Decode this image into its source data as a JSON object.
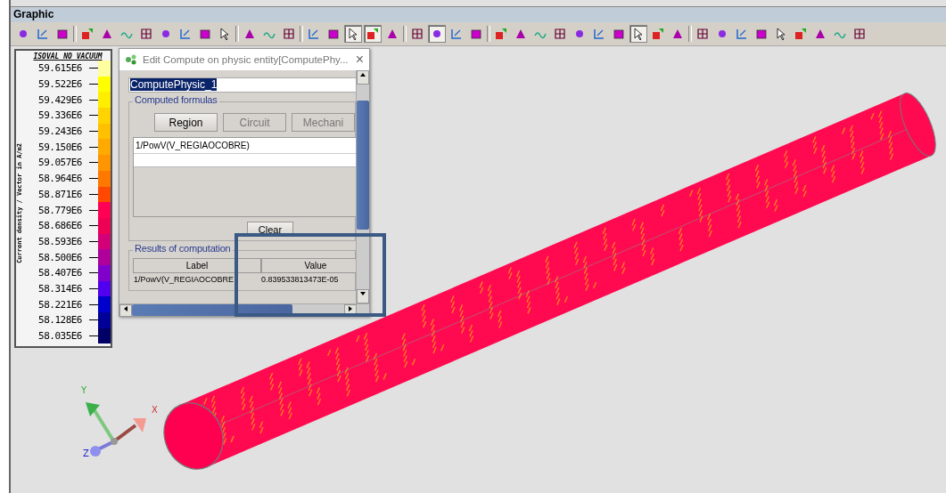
{
  "window": {
    "title": "Graphic"
  },
  "toolbar": [
    {
      "kind": "tool",
      "pressed": false
    },
    {
      "kind": "tool",
      "pressed": false
    },
    {
      "kind": "tool",
      "pressed": false
    },
    {
      "kind": "separator"
    },
    {
      "kind": "tool",
      "pressed": false
    },
    {
      "kind": "tool",
      "pressed": false
    },
    {
      "kind": "tool",
      "pressed": false
    },
    {
      "kind": "tool",
      "pressed": false
    },
    {
      "kind": "tool",
      "pressed": false
    },
    {
      "kind": "tool",
      "pressed": false
    },
    {
      "kind": "tool",
      "pressed": false
    },
    {
      "kind": "tool",
      "pressed": false
    },
    {
      "kind": "separator"
    },
    {
      "kind": "tool",
      "pressed": false
    },
    {
      "kind": "tool",
      "pressed": false
    },
    {
      "kind": "tool",
      "pressed": false
    },
    {
      "kind": "separator"
    },
    {
      "kind": "tool",
      "pressed": false
    },
    {
      "kind": "tool",
      "pressed": false
    },
    {
      "kind": "tool",
      "pressed": true
    },
    {
      "kind": "tool",
      "pressed": true
    },
    {
      "kind": "tool",
      "pressed": false
    },
    {
      "kind": "separator"
    },
    {
      "kind": "tool",
      "pressed": false
    },
    {
      "kind": "tool",
      "pressed": true
    },
    {
      "kind": "tool",
      "pressed": false
    },
    {
      "kind": "tool",
      "pressed": false
    },
    {
      "kind": "separator"
    },
    {
      "kind": "tool",
      "pressed": false
    },
    {
      "kind": "tool",
      "pressed": false
    },
    {
      "kind": "tool",
      "pressed": false
    },
    {
      "kind": "tool",
      "pressed": false
    },
    {
      "kind": "tool",
      "pressed": false
    },
    {
      "kind": "tool",
      "pressed": false
    },
    {
      "kind": "tool",
      "pressed": false
    },
    {
      "kind": "tool",
      "pressed": true
    },
    {
      "kind": "tool",
      "pressed": false
    },
    {
      "kind": "tool",
      "pressed": false
    },
    {
      "kind": "separator"
    },
    {
      "kind": "tool",
      "pressed": false
    },
    {
      "kind": "tool",
      "pressed": false
    },
    {
      "kind": "tool",
      "pressed": false
    },
    {
      "kind": "tool",
      "pressed": false
    },
    {
      "kind": "tool",
      "pressed": false
    },
    {
      "kind": "tool",
      "pressed": false
    },
    {
      "kind": "tool",
      "pressed": false
    },
    {
      "kind": "tool",
      "pressed": false
    },
    {
      "kind": "tool",
      "pressed": false
    }
  ],
  "legend": {
    "title": "ISOVAL_NO_VACUUM",
    "axis_label": "Current density / Vector in A/m2",
    "rows": [
      {
        "value": "59.615E6",
        "color": "#ffffa0"
      },
      {
        "value": "59.522E6",
        "color": "#ffff00"
      },
      {
        "value": "59.429E6",
        "color": "#ffee00"
      },
      {
        "value": "59.336E6",
        "color": "#ffd400"
      },
      {
        "value": "59.243E6",
        "color": "#ffc000"
      },
      {
        "value": "59.150E6",
        "color": "#ffaa00"
      },
      {
        "value": "59.057E6",
        "color": "#ff9500"
      },
      {
        "value": "58.964E6",
        "color": "#ff7800"
      },
      {
        "value": "58.871E6",
        "color": "#ff4800"
      },
      {
        "value": "58.779E6",
        "color": "#ff0055"
      },
      {
        "value": "58.686E6",
        "color": "#ee0055"
      },
      {
        "value": "58.593E6",
        "color": "#d40078"
      },
      {
        "value": "58.500E6",
        "color": "#b0009c"
      },
      {
        "value": "58.407E6",
        "color": "#8000cc"
      },
      {
        "value": "58.314E6",
        "color": "#5000ee"
      },
      {
        "value": "58.221E6",
        "color": "#0000cc"
      },
      {
        "value": "58.128E6",
        "color": "#000099"
      },
      {
        "value": "58.035E6",
        "color": "#000066"
      }
    ]
  },
  "dialog": {
    "title": "Edit Compute on physic entity[ComputePhy...",
    "close": "×",
    "storage_name": {
      "value": "ComputePhysic_1",
      "selected": true
    },
    "formulas_group": {
      "title": "Computed formulas",
      "buttons": [
        {
          "label": "Region",
          "disabled": false
        },
        {
          "label": "Circuit",
          "disabled": true
        },
        {
          "label": "Mechani",
          "disabled": true
        }
      ],
      "list": [
        "1/PowV(V_REGIAOCOBRE)"
      ],
      "clear_button": "Clear"
    },
    "results_group": {
      "title": "Results of computation",
      "columns": [
        "Label",
        "Value"
      ],
      "rows": [
        [
          "1/PowV(V_REGIAOCOBRE",
          "0.839533813473E-05"
        ]
      ]
    }
  },
  "axes": {
    "x": "X",
    "y": "Y",
    "z": "Z"
  }
}
